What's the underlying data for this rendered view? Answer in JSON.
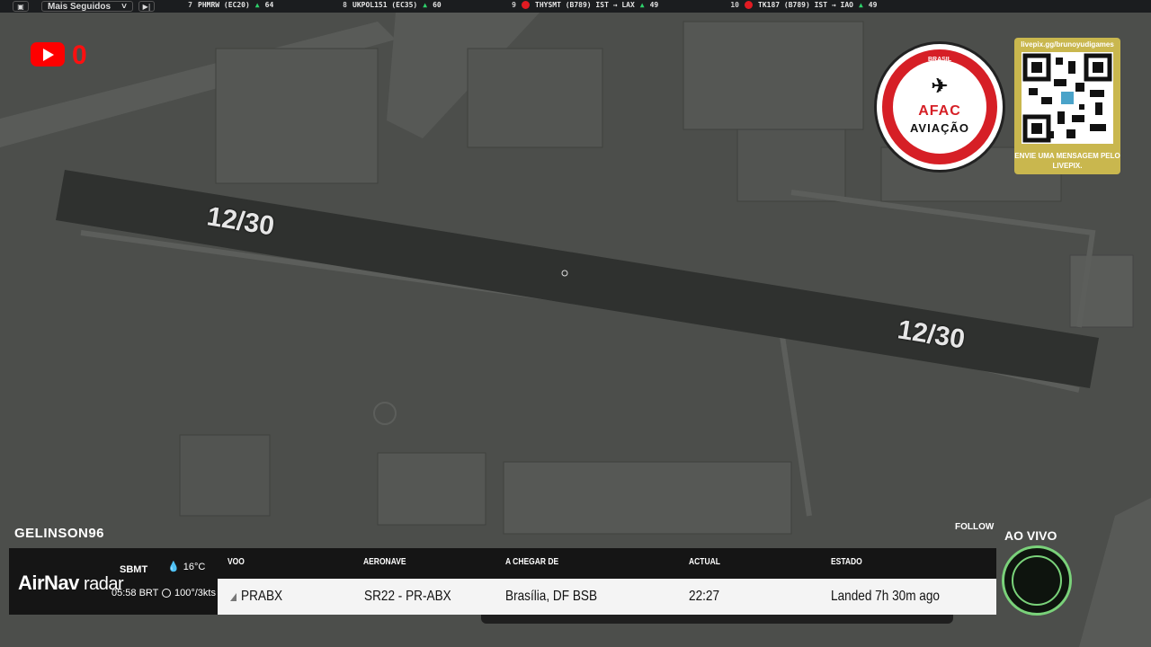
{
  "ticker": {
    "select_label": "Mais Seguidos",
    "items": [
      {
        "rank": "7",
        "flight": "PHMRW (EC20)",
        "followers": "64",
        "flag": false
      },
      {
        "rank": "8",
        "flight": "UKPOL151 (EC35)",
        "followers": "60",
        "flag": false
      },
      {
        "rank": "9",
        "flight": "THYSMT (B789) IST → LAX",
        "followers": "49",
        "flag": true
      },
      {
        "rank": "10",
        "flight": "TK187 (B789) IST → IAO",
        "followers": "49",
        "flag": true
      }
    ]
  },
  "map": {
    "runway_label_1": "12/30",
    "runway_label_2": "12/30"
  },
  "youtube": {
    "count": "0"
  },
  "afac": {
    "line1": "AFAC",
    "line2": "AVIAÇÃO",
    "top": "BRASIL"
  },
  "qr": {
    "url": "livepix.gg/brunoyudigames",
    "message": "ENVIE UMA MENSAGEM PELO LIVEPIX."
  },
  "overlay": {
    "streamer": "GELINSON96",
    "follow": "FOLLOW",
    "live": "AO VIVO"
  },
  "airnav": {
    "brand_bold": "AirNav",
    "brand_light": " radar",
    "icao": "SBMT",
    "time": "05:58 BRT",
    "temp": "16°C",
    "wind": "100°/3kts"
  },
  "table": {
    "headers": [
      "VOO",
      "AERONAVE",
      "A CHEGAR DE",
      "ACTUAL",
      "ESTADO"
    ],
    "row": {
      "flight": "PRABX",
      "aircraft": "SR22 - PR-ABX",
      "origin": "Brasília, DF BSB",
      "actual": "22:27",
      "status": "Landed 7h 30m ago"
    }
  },
  "colors": {
    "runway": "#2f312f",
    "map_bg": "#4d4f4c",
    "live_red": "#ff0000",
    "accent_green": "#2ed36b"
  }
}
